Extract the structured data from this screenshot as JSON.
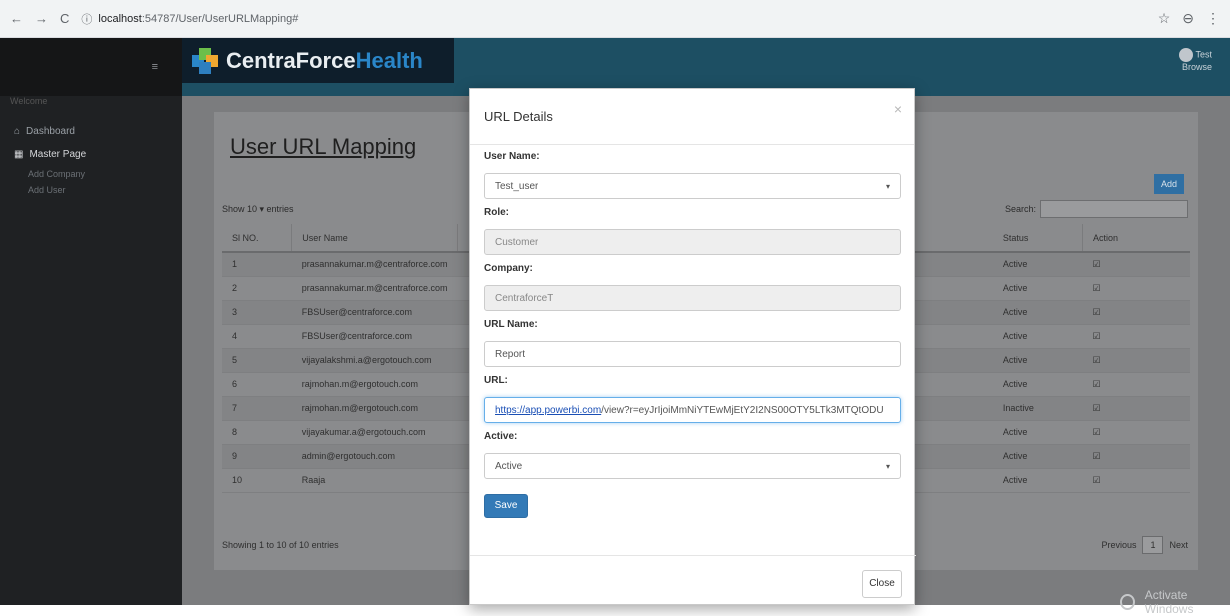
{
  "browser": {
    "url_host": "localhost",
    "url_path": ":54787/User/UserURLMapping#",
    "back_icon": "arrow-left-icon",
    "forward_icon": "arrow-right-icon",
    "reload_icon": "reload-icon"
  },
  "sidebar": {
    "user_line": "Welcome",
    "items": [
      {
        "label": "Dashboard",
        "icon": "home-icon"
      },
      {
        "label": "Master Page",
        "icon": "grid-icon"
      }
    ],
    "sub_items": [
      "Add Company",
      "Add User"
    ]
  },
  "header": {
    "brand_main": "CentraForce",
    "brand_accent": "Health",
    "profile_name": "Test",
    "profile_sub": "Browse"
  },
  "page": {
    "title": "User URL Mapping",
    "add_label": "Add",
    "show_entries": "Show  10  ▾  entries",
    "search_label": "Search:",
    "columns": [
      "Sl NO.",
      "User Name",
      "",
      "Status",
      "Action"
    ],
    "rows": [
      {
        "no": "1",
        "user": "prasannakumar.m@centraforce.com",
        "status": "Active",
        "action": "☑"
      },
      {
        "no": "2",
        "user": "prasannakumar.m@centraforce.com",
        "status": "Active",
        "action": "☑"
      },
      {
        "no": "3",
        "user": "FBSUser@centraforce.com",
        "status": "Active",
        "action": "☑"
      },
      {
        "no": "4",
        "user": "FBSUser@centraforce.com",
        "status": "Active",
        "action": "☑"
      },
      {
        "no": "5",
        "user": "vijayalakshmi.a@ergotouch.com",
        "status": "Active",
        "action": "☑"
      },
      {
        "no": "6",
        "user": "rajmohan.m@ergotouch.com",
        "status": "Active",
        "action": "☑"
      },
      {
        "no": "7",
        "user": "rajmohan.m@ergotouch.com",
        "status": "Inactive",
        "action": "☑"
      },
      {
        "no": "8",
        "user": "vijayakumar.a@ergotouch.com",
        "status": "Active",
        "action": "☑"
      },
      {
        "no": "9",
        "user": "admin@ergotouch.com",
        "status": "Active",
        "action": "☑"
      },
      {
        "no": "10",
        "user": "Raaja",
        "status": "Active",
        "action": "☑"
      }
    ],
    "showing": "Showing 1 to 10 of 10 entries",
    "pager_prev": "Previous",
    "pager_current": "1",
    "pager_next": "Next"
  },
  "modal": {
    "title": "URL Details",
    "close_glyph": "×",
    "fields": {
      "user_name": {
        "label": "User Name:",
        "value": "Test_user"
      },
      "role": {
        "label": "Role:",
        "value": "Customer"
      },
      "company": {
        "label": "Company:",
        "value": "CentraforceT"
      },
      "url_name": {
        "label": "URL Name:",
        "value": "Report"
      },
      "url": {
        "label": "URL:",
        "link": "https://app.powerbi.com",
        "rest": "/view?r=eyJrIjoiMmNiYTEwMjEtY2I2NS00OTY5LTk3MTQtODU"
      },
      "active": {
        "label": "Active:",
        "value": "Active"
      }
    },
    "save_label": "Save",
    "close_label": "Close"
  },
  "watermark": "Activate Windows"
}
